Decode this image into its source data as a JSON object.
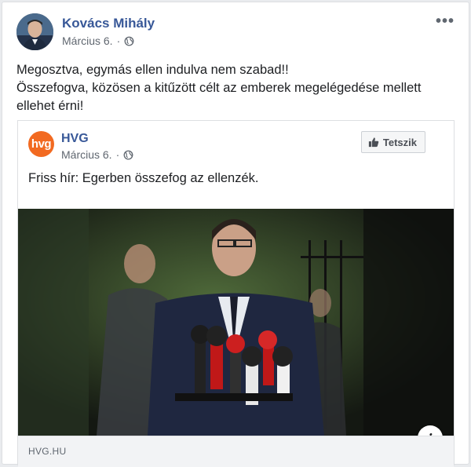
{
  "post": {
    "author": "Kovács Mihály",
    "date": "Március 6.",
    "separator": "·",
    "more_label": "•••",
    "text_lines": [
      "Megosztva, egymás ellen indulva nem szabad!!",
      "Összefogva, közösen a kitűzött célt az emberek megelégedése mellett",
      "ellehet érni!"
    ]
  },
  "shared": {
    "page_logo": "hvg",
    "page_name": "HVG",
    "date": "Március 6.",
    "separator": "·",
    "like_label": "Tetszik",
    "text": "Friss hír: Egerben összefog az ellenzék.",
    "info_label": "i",
    "domain": "HVG.HU"
  },
  "colors": {
    "link_blue": "#385898",
    "hvg_orange": "#f26a21",
    "muted": "#606770"
  },
  "icons": [
    "globe-icon",
    "thumbs-up-icon",
    "info-icon",
    "more-icon"
  ]
}
